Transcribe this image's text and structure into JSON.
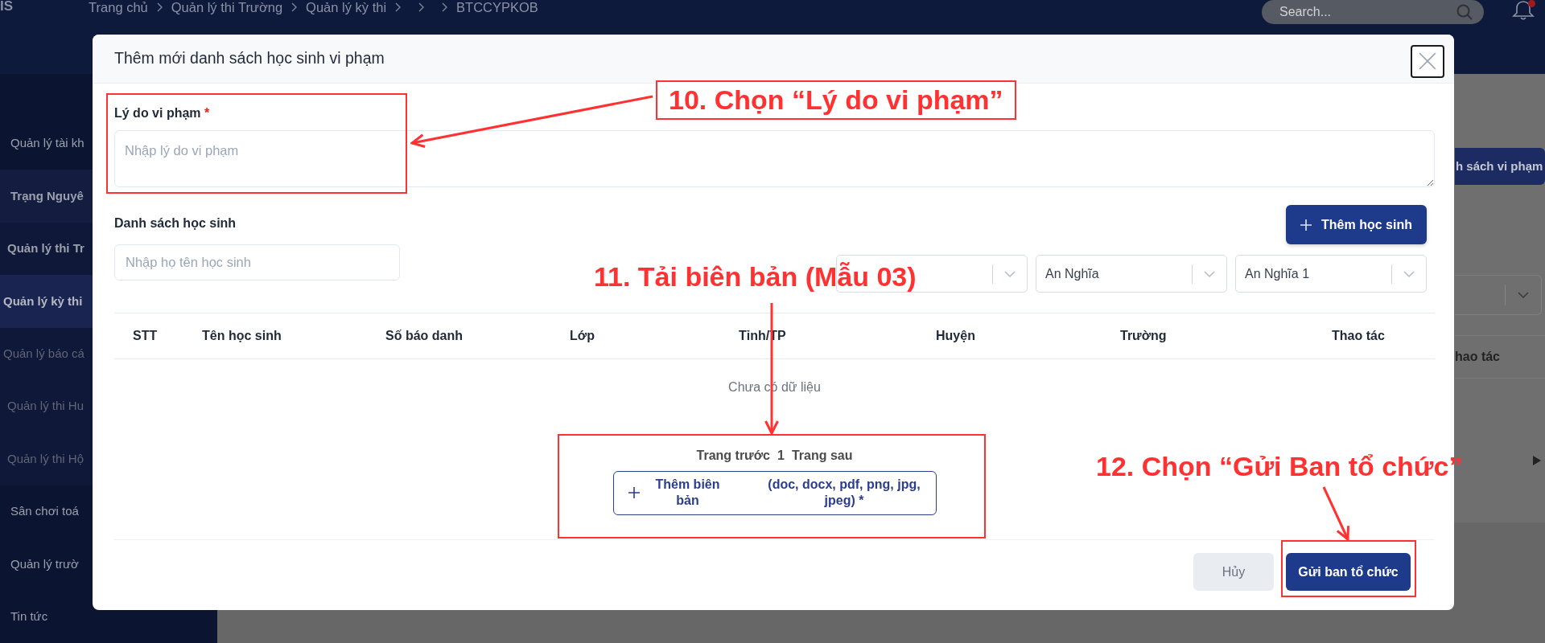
{
  "header": {
    "logo_text": "IS",
    "breadcrumb": [
      {
        "kind": "crumb",
        "text": "Trang chủ"
      },
      {
        "kind": "separator"
      },
      {
        "kind": "crumb",
        "text": "Quản lý thi Trường"
      },
      {
        "kind": "separator"
      },
      {
        "kind": "crumb",
        "text": "Quản lý kỳ thi"
      },
      {
        "kind": "separator"
      },
      {
        "kind": "separator"
      },
      {
        "kind": "separator"
      },
      {
        "kind": "crumb",
        "text": "BTCCYPKOB"
      }
    ],
    "search": {
      "placeholder": "Search..."
    },
    "notifications": {
      "unread": true
    }
  },
  "sidebar": {
    "items": [
      {
        "label": "Quản lý tài kh",
        "expanded": false,
        "selected": false
      },
      {
        "label": "Trạng Nguyê",
        "expanded": true,
        "selected": false,
        "children": [
          {
            "label": "Quản lý thi Tr",
            "expanded": true,
            "selected": false,
            "children": [
              {
                "label": "Quản lý kỳ thi",
                "expanded": false,
                "selected": true
              },
              {
                "label": "Quản lý báo cá",
                "expanded": false,
                "selected": false
              }
            ]
          },
          {
            "label": "Quản lý thi Hu",
            "expanded": false,
            "selected": false
          },
          {
            "label": "Quản lý thi Hộ",
            "expanded": false,
            "selected": false
          }
        ]
      },
      {
        "label": "Sân chơi toá",
        "expanded": false,
        "selected": false
      },
      {
        "label": "Quản lý trườ",
        "expanded": false,
        "selected": false
      },
      {
        "label": "Tin tức",
        "expanded": false,
        "selected": false
      }
    ]
  },
  "background_page": {
    "action_button": "h sách vi phạm",
    "column_header": "hao tác"
  },
  "dialog": {
    "title": "Thêm mới danh sách học sinh vi phạm",
    "reason": {
      "label": "Lý do vi phạm",
      "required_mark": "*",
      "placeholder": "Nhập lý do vi phạm"
    },
    "students": {
      "label": "Danh sách học sinh",
      "search": {
        "placeholder": "Nhập họ tên học sinh"
      },
      "add_button": "Thêm học sinh",
      "filters": [
        {
          "expanded": false
        },
        {
          "value": "An Nghĩa",
          "expanded": false
        },
        {
          "value": "An Nghĩa 1",
          "expanded": false
        }
      ]
    },
    "table": {
      "columns": [
        "STT",
        "Tên học sinh",
        "Số báo danh",
        "Lớp",
        "Tỉnh/TP",
        "Huyện",
        "Trường",
        "Thao tác"
      ],
      "empty_text": "Chưa có dữ liệu"
    },
    "pagination": {
      "previous": "Trang trước",
      "page": "1",
      "next": "Trang sau"
    },
    "upload": {
      "label": "Thêm biên bản",
      "formats": "(doc, docx, pdf, png, jpg, jpeg) *"
    },
    "footer_buttons": [
      {
        "kind": "secondary",
        "label": "Hủy"
      },
      {
        "kind": "primary",
        "label": "Gửi ban tổ chức"
      }
    ]
  },
  "annotations": [
    {
      "kind": "callout",
      "text": "10. Chọn “Lý do vi phạm”"
    },
    {
      "kind": "caption",
      "text": "11. Tải biên bản (Mẫu 03)"
    },
    {
      "kind": "caption",
      "text": "12. Chọn “Gửi Ban tổ chức”"
    }
  ]
}
